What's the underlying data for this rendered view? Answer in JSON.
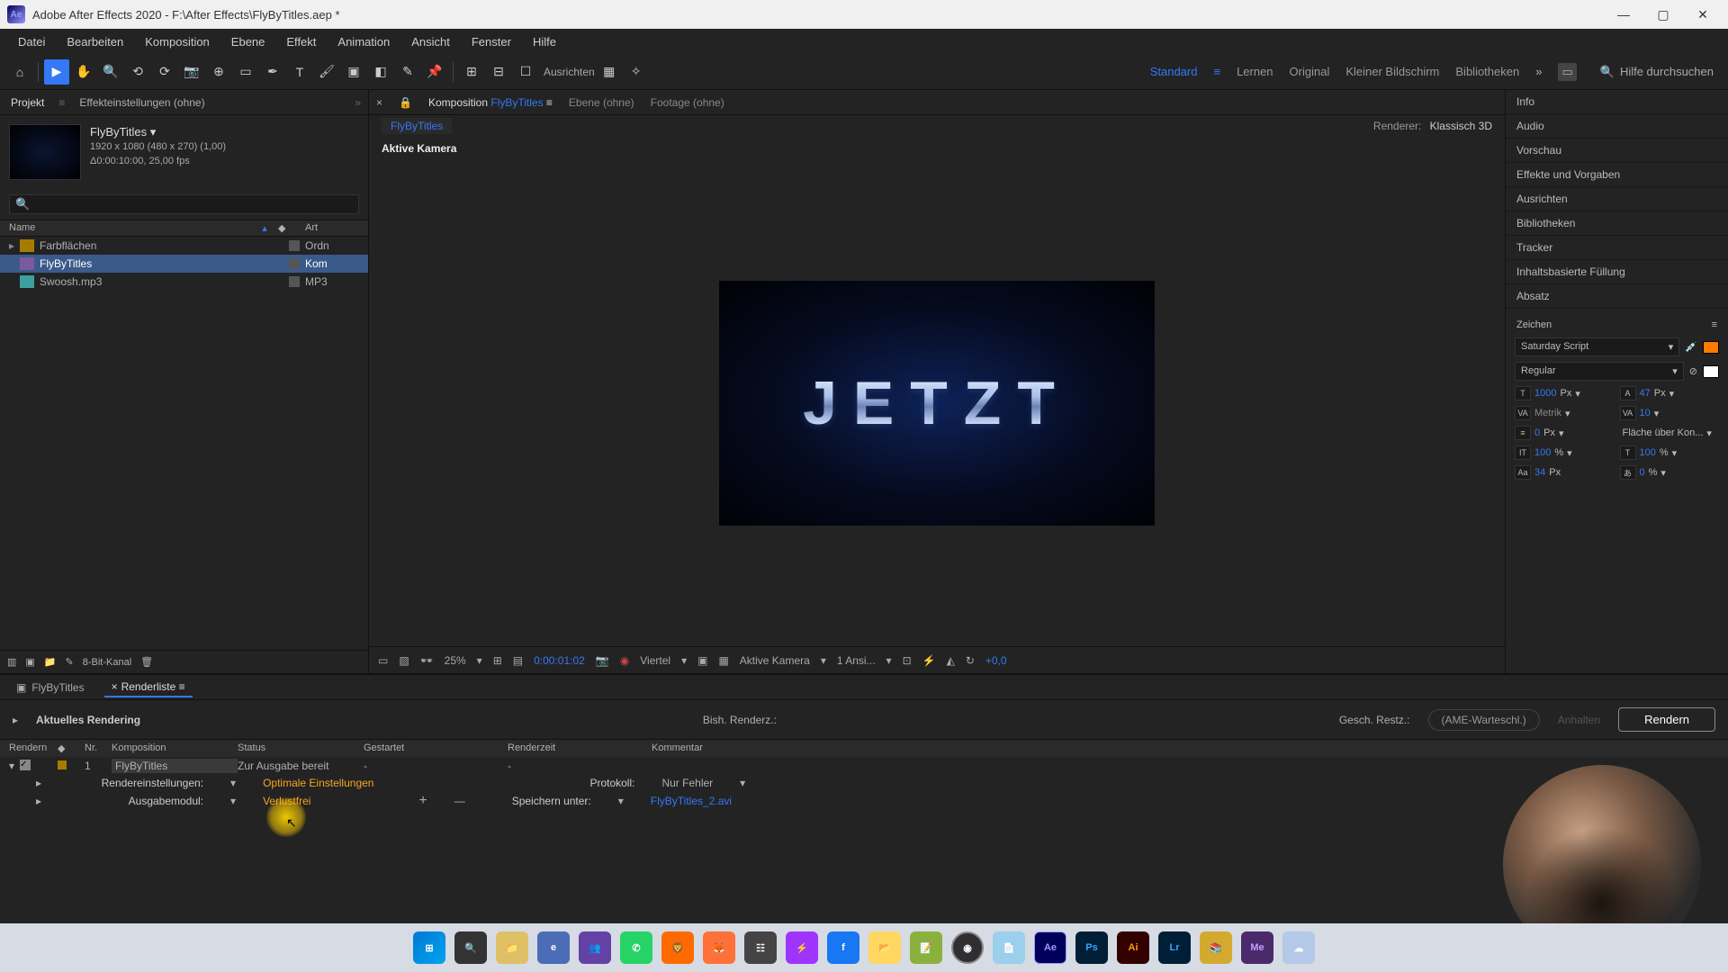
{
  "titlebar": {
    "text": "Adobe After Effects 2020 - F:\\After Effects\\FlyByTitles.aep *"
  },
  "menu": [
    "Datei",
    "Bearbeiten",
    "Komposition",
    "Ebene",
    "Effekt",
    "Animation",
    "Ansicht",
    "Fenster",
    "Hilfe"
  ],
  "toolbar": {
    "snap_label": "Ausrichten"
  },
  "workspaces": {
    "items": [
      "Standard",
      "Lernen",
      "Original",
      "Kleiner Bildschirm",
      "Bibliotheken"
    ],
    "search_ph": "Hilfe durchsuchen"
  },
  "project": {
    "tab_project": "Projekt",
    "tab_fx": "Effekteinstellungen (ohne)",
    "name": "FlyByTitles ▾",
    "meta1": "1920 x 1080 (480 x 270) (1,00)",
    "meta2": "Δ0:00:10:00, 25,00 fps",
    "head_name": "Name",
    "head_art": "Art",
    "items": [
      {
        "icon": "folder-ic",
        "name": "Farbflächen",
        "art": "Ordn"
      },
      {
        "icon": "comp-ic",
        "name": "FlyByTitles",
        "art": "Kom",
        "sel": true
      },
      {
        "icon": "audio-ic",
        "name": "Swoosh.mp3",
        "art": "MP3"
      }
    ],
    "footer": "8-Bit-Kanal"
  },
  "viewer": {
    "tabs": {
      "comp_pre": "Komposition ",
      "comp_link": "FlyByTitles",
      "ebene": "Ebene (ohne)",
      "footage": "Footage (ohne)"
    },
    "crumb": "FlyByTitles",
    "renderer_lbl": "Renderer:",
    "renderer_val": "Klassisch 3D",
    "active_cam": "Aktive Kamera",
    "frame_text": "JETZT",
    "footer": {
      "zoom": "25%",
      "tc": "0:00:01:02",
      "res": "Viertel",
      "cam": "Aktive Kamera",
      "views": "1 Ansi...",
      "plus": "+0,0"
    }
  },
  "rightPanels": [
    "Info",
    "Audio",
    "Vorschau",
    "Effekte und Vorgaben",
    "Ausrichten",
    "Bibliotheken",
    "Tracker",
    "Inhaltsbasierte Füllung",
    "Absatz"
  ],
  "char": {
    "title": "Zeichen",
    "font": "Saturday Script",
    "weight": "Regular",
    "size": "1000",
    "size_u": "Px",
    "lead": "47",
    "lead_u": "Px",
    "kern": "Metrik",
    "track": "10",
    "stroke": "0",
    "stroke_u": "Px",
    "strokeStyle": "Fläche über Kon...",
    "vscale": "100",
    "vscale_u": "%",
    "hscale": "100",
    "hscale_u": "%",
    "baseline": "34",
    "baseline_u": "Px",
    "tsume": "0",
    "tsume_u": "%"
  },
  "timeline": {
    "tab_comp": "FlyByTitles",
    "tab_render": "Renderliste",
    "cur": "Aktuelles Rendering",
    "bish": "Bish. Renderz.:",
    "gesch": "Gesch. Restz.:",
    "ame": "(AME-Warteschl.)",
    "anhalten": "Anhalten",
    "render": "Rendern",
    "head": {
      "r": "Rendern",
      "nr": "Nr.",
      "komp": "Komposition",
      "status": "Status",
      "gest": "Gestartet",
      "rz": "Renderzeit",
      "kom": "Kommentar"
    },
    "row": {
      "nr": "1",
      "komp": "FlyByTitles",
      "status": "Zur Ausgabe bereit",
      "gest": "-",
      "rz": "-"
    },
    "det": {
      "rend_lbl": "Rendereinstellungen:",
      "rend_val": "Optimale Einstellungen",
      "out_lbl": "Ausgabemodul:",
      "out_val": "Verlustfrei",
      "proto_lbl": "Protokoll:",
      "proto_val": "Nur Fehler",
      "save_lbl": "Speichern unter:",
      "save_val": "FlyByTitles_2.avi",
      "plus": "+"
    }
  },
  "taskbar": [
    "win",
    "srch",
    "fld",
    "ed",
    "tm",
    "wa",
    "b",
    "ff",
    "st",
    "msg",
    "fb",
    "exp",
    "sn",
    "obs",
    "np",
    "ae",
    "ps",
    "ai",
    "lr",
    "bk",
    "me",
    "dd"
  ]
}
